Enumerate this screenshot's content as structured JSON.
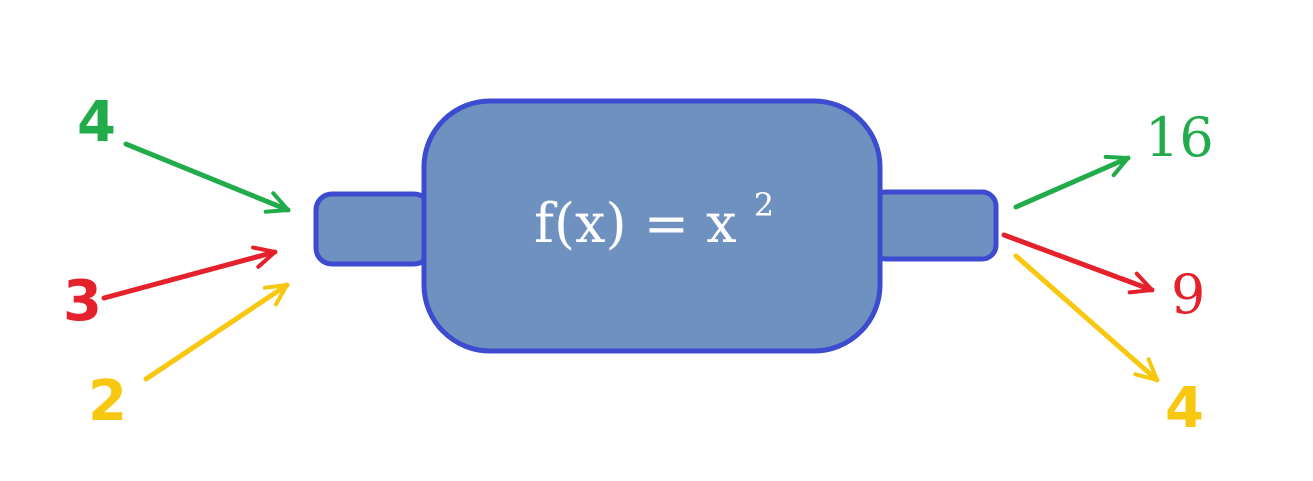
{
  "formula": {
    "base": "f(x) = x",
    "exponent": "2"
  },
  "inputs": [
    {
      "label": "4",
      "color": "#22ab4a"
    },
    {
      "label": "3",
      "color": "#e5212b"
    },
    {
      "label": "2",
      "color": "#f8c70f"
    }
  ],
  "outputs": [
    {
      "label": "16",
      "color": "#22ab4a"
    },
    {
      "label": "9",
      "color": "#e5212b"
    },
    {
      "label": "4",
      "color": "#f8c70f"
    }
  ],
  "machine": {
    "fill": "#6f91bf",
    "stroke": "#3c4bcf"
  }
}
